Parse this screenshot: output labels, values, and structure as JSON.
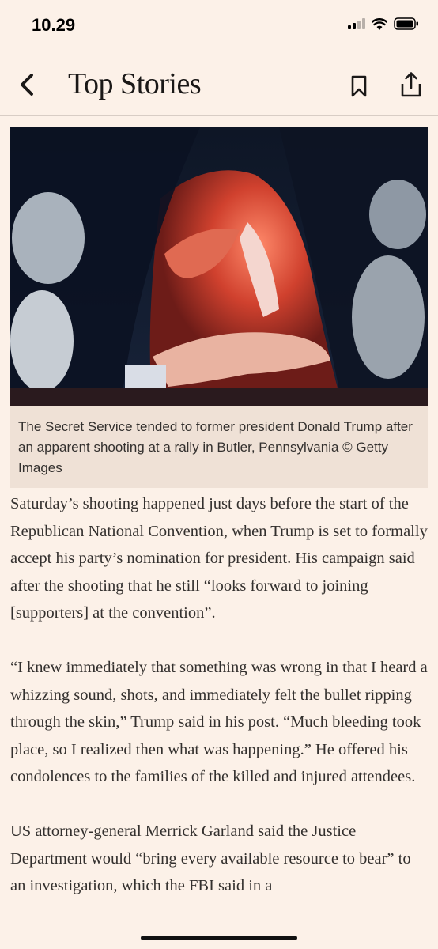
{
  "status_bar": {
    "time": "10.29",
    "icons": [
      "signal-icon",
      "wifi-icon",
      "battery-icon"
    ]
  },
  "nav": {
    "title": "Top Stories",
    "back_icon": "chevron-left-icon",
    "bookmark_icon": "bookmark-icon",
    "share_icon": "share-icon"
  },
  "figure": {
    "caption": "The Secret Service tended to former president Donald Trump after an apparent shooting at a rally in Butler, Pennsylvania © Getty Images"
  },
  "article": {
    "paragraphs": [
      "Saturday’s shooting happened just days before the start of the Republican National Convention, when Trump is set to formally accept his party’s nomination for president. His campaign said after the shooting that he still “looks forward to joining [supporters] at the convention”.",
      "“I knew immediately that something was wrong in that I heard a whizzing sound, shots, and immediately felt the bullet ripping through the skin,” Trump said in his post. “Much bleeding took place, so I realized then what was happening.” He offered his condolences to the families of the killed and injured attendees.",
      "US attorney-general Merrick Garland said the Justice Department would “bring every available resource to bear” to an investigation, which the FBI said in a"
    ]
  },
  "colors": {
    "background": "#fcf1e8",
    "caption_background": "#efe1d6",
    "text": "#33302e"
  }
}
